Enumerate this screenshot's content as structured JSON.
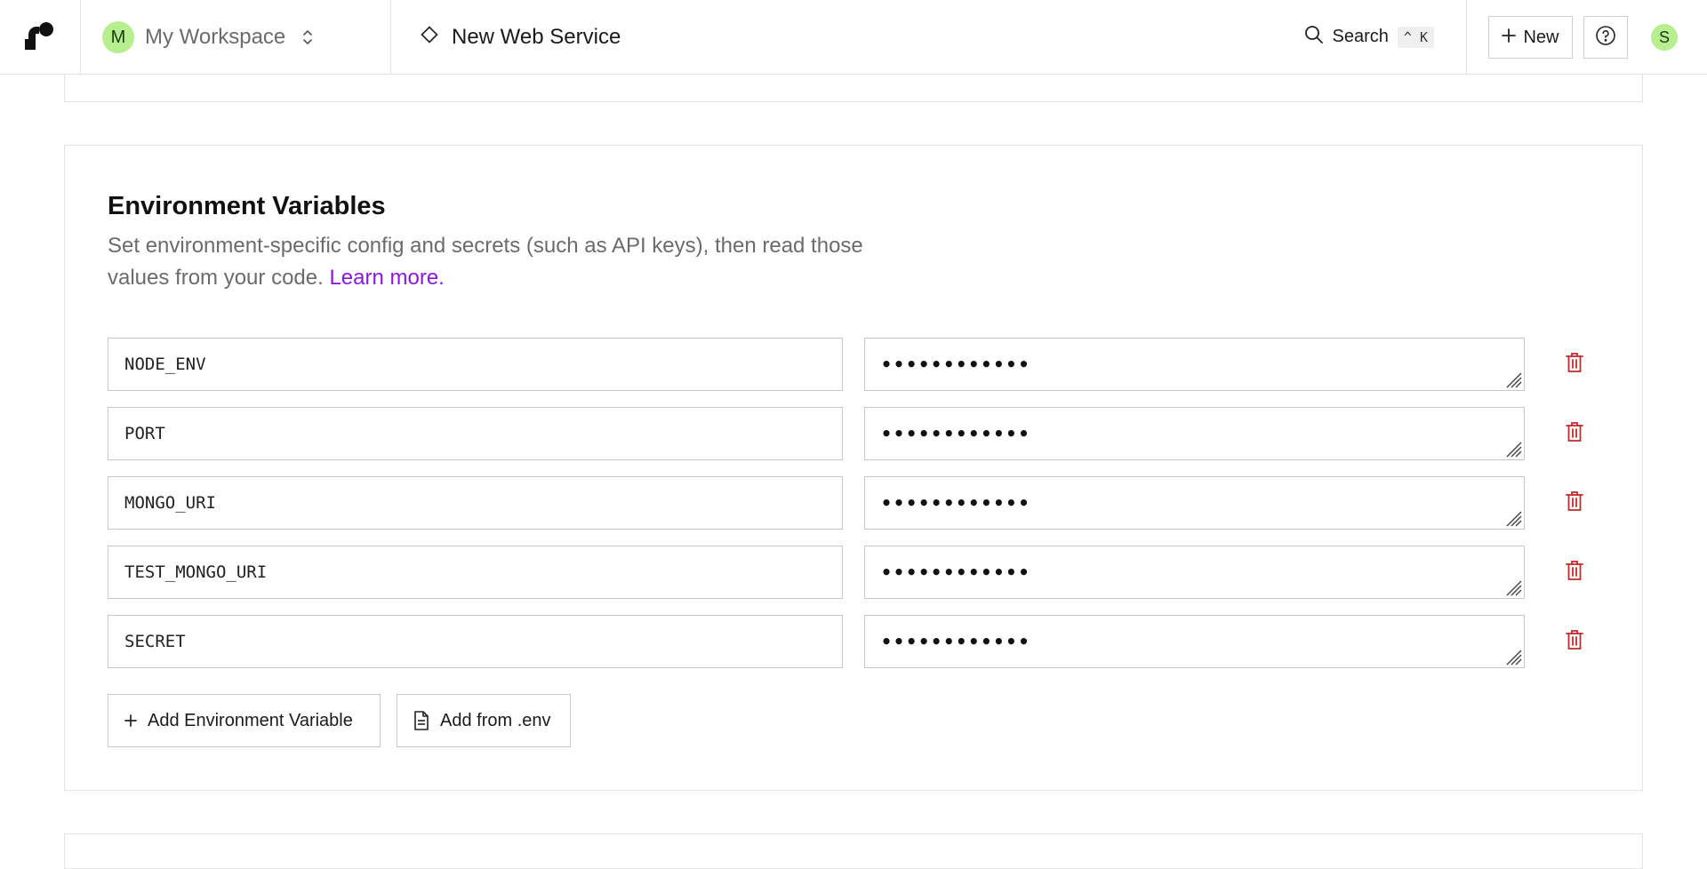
{
  "topbar": {
    "logo_icon": "render-logo-icon",
    "workspace": {
      "avatar_letter": "M",
      "name": "My Workspace",
      "switch_icon": "chevrons-up-down-icon"
    },
    "service": {
      "icon": "diamond-icon",
      "title": "New Web Service"
    },
    "search": {
      "label": "Search",
      "shortcut": "^ K"
    },
    "new_label": "New",
    "help_icon": "help-circle-icon",
    "user_avatar_letter": "S"
  },
  "env_section": {
    "title": "Environment Variables",
    "description": "Set environment-specific config and secrets (such as API keys), then read those values from your code.",
    "learn_more": "Learn more.",
    "variables": [
      {
        "key": "NODE_ENV",
        "value_masked": "••••••••••••"
      },
      {
        "key": "PORT",
        "value_masked": "••••••••••••"
      },
      {
        "key": "MONGO_URI",
        "value_masked": "••••••••••••"
      },
      {
        "key": "TEST_MONGO_URI",
        "value_masked": "••••••••••••"
      },
      {
        "key": "SECRET",
        "value_masked": "••••••••••••"
      }
    ],
    "add_variable_label": "Add Environment Variable",
    "add_from_env_label": "Add from .env"
  },
  "colors": {
    "accent_link": "#8a18e0",
    "avatar_bg": "#b7ee8f",
    "delete_icon": "#c2282d",
    "border": "#c8c8c8"
  }
}
